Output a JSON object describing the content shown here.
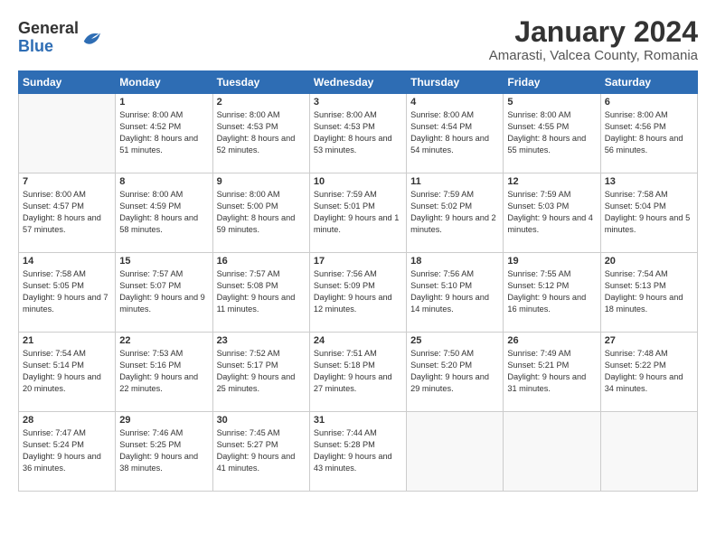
{
  "header": {
    "logo_general": "General",
    "logo_blue": "Blue",
    "month_title": "January 2024",
    "subtitle": "Amarasti, Valcea County, Romania"
  },
  "weekdays": [
    "Sunday",
    "Monday",
    "Tuesday",
    "Wednesday",
    "Thursday",
    "Friday",
    "Saturday"
  ],
  "weeks": [
    [
      {
        "day": "",
        "sunrise": "",
        "sunset": "",
        "daylight": ""
      },
      {
        "day": "1",
        "sunrise": "Sunrise: 8:00 AM",
        "sunset": "Sunset: 4:52 PM",
        "daylight": "Daylight: 8 hours and 51 minutes."
      },
      {
        "day": "2",
        "sunrise": "Sunrise: 8:00 AM",
        "sunset": "Sunset: 4:53 PM",
        "daylight": "Daylight: 8 hours and 52 minutes."
      },
      {
        "day": "3",
        "sunrise": "Sunrise: 8:00 AM",
        "sunset": "Sunset: 4:53 PM",
        "daylight": "Daylight: 8 hours and 53 minutes."
      },
      {
        "day": "4",
        "sunrise": "Sunrise: 8:00 AM",
        "sunset": "Sunset: 4:54 PM",
        "daylight": "Daylight: 8 hours and 54 minutes."
      },
      {
        "day": "5",
        "sunrise": "Sunrise: 8:00 AM",
        "sunset": "Sunset: 4:55 PM",
        "daylight": "Daylight: 8 hours and 55 minutes."
      },
      {
        "day": "6",
        "sunrise": "Sunrise: 8:00 AM",
        "sunset": "Sunset: 4:56 PM",
        "daylight": "Daylight: 8 hours and 56 minutes."
      }
    ],
    [
      {
        "day": "7",
        "sunrise": "Sunrise: 8:00 AM",
        "sunset": "Sunset: 4:57 PM",
        "daylight": "Daylight: 8 hours and 57 minutes."
      },
      {
        "day": "8",
        "sunrise": "Sunrise: 8:00 AM",
        "sunset": "Sunset: 4:59 PM",
        "daylight": "Daylight: 8 hours and 58 minutes."
      },
      {
        "day": "9",
        "sunrise": "Sunrise: 8:00 AM",
        "sunset": "Sunset: 5:00 PM",
        "daylight": "Daylight: 8 hours and 59 minutes."
      },
      {
        "day": "10",
        "sunrise": "Sunrise: 7:59 AM",
        "sunset": "Sunset: 5:01 PM",
        "daylight": "Daylight: 9 hours and 1 minute."
      },
      {
        "day": "11",
        "sunrise": "Sunrise: 7:59 AM",
        "sunset": "Sunset: 5:02 PM",
        "daylight": "Daylight: 9 hours and 2 minutes."
      },
      {
        "day": "12",
        "sunrise": "Sunrise: 7:59 AM",
        "sunset": "Sunset: 5:03 PM",
        "daylight": "Daylight: 9 hours and 4 minutes."
      },
      {
        "day": "13",
        "sunrise": "Sunrise: 7:58 AM",
        "sunset": "Sunset: 5:04 PM",
        "daylight": "Daylight: 9 hours and 5 minutes."
      }
    ],
    [
      {
        "day": "14",
        "sunrise": "Sunrise: 7:58 AM",
        "sunset": "Sunset: 5:05 PM",
        "daylight": "Daylight: 9 hours and 7 minutes."
      },
      {
        "day": "15",
        "sunrise": "Sunrise: 7:57 AM",
        "sunset": "Sunset: 5:07 PM",
        "daylight": "Daylight: 9 hours and 9 minutes."
      },
      {
        "day": "16",
        "sunrise": "Sunrise: 7:57 AM",
        "sunset": "Sunset: 5:08 PM",
        "daylight": "Daylight: 9 hours and 11 minutes."
      },
      {
        "day": "17",
        "sunrise": "Sunrise: 7:56 AM",
        "sunset": "Sunset: 5:09 PM",
        "daylight": "Daylight: 9 hours and 12 minutes."
      },
      {
        "day": "18",
        "sunrise": "Sunrise: 7:56 AM",
        "sunset": "Sunset: 5:10 PM",
        "daylight": "Daylight: 9 hours and 14 minutes."
      },
      {
        "day": "19",
        "sunrise": "Sunrise: 7:55 AM",
        "sunset": "Sunset: 5:12 PM",
        "daylight": "Daylight: 9 hours and 16 minutes."
      },
      {
        "day": "20",
        "sunrise": "Sunrise: 7:54 AM",
        "sunset": "Sunset: 5:13 PM",
        "daylight": "Daylight: 9 hours and 18 minutes."
      }
    ],
    [
      {
        "day": "21",
        "sunrise": "Sunrise: 7:54 AM",
        "sunset": "Sunset: 5:14 PM",
        "daylight": "Daylight: 9 hours and 20 minutes."
      },
      {
        "day": "22",
        "sunrise": "Sunrise: 7:53 AM",
        "sunset": "Sunset: 5:16 PM",
        "daylight": "Daylight: 9 hours and 22 minutes."
      },
      {
        "day": "23",
        "sunrise": "Sunrise: 7:52 AM",
        "sunset": "Sunset: 5:17 PM",
        "daylight": "Daylight: 9 hours and 25 minutes."
      },
      {
        "day": "24",
        "sunrise": "Sunrise: 7:51 AM",
        "sunset": "Sunset: 5:18 PM",
        "daylight": "Daylight: 9 hours and 27 minutes."
      },
      {
        "day": "25",
        "sunrise": "Sunrise: 7:50 AM",
        "sunset": "Sunset: 5:20 PM",
        "daylight": "Daylight: 9 hours and 29 minutes."
      },
      {
        "day": "26",
        "sunrise": "Sunrise: 7:49 AM",
        "sunset": "Sunset: 5:21 PM",
        "daylight": "Daylight: 9 hours and 31 minutes."
      },
      {
        "day": "27",
        "sunrise": "Sunrise: 7:48 AM",
        "sunset": "Sunset: 5:22 PM",
        "daylight": "Daylight: 9 hours and 34 minutes."
      }
    ],
    [
      {
        "day": "28",
        "sunrise": "Sunrise: 7:47 AM",
        "sunset": "Sunset: 5:24 PM",
        "daylight": "Daylight: 9 hours and 36 minutes."
      },
      {
        "day": "29",
        "sunrise": "Sunrise: 7:46 AM",
        "sunset": "Sunset: 5:25 PM",
        "daylight": "Daylight: 9 hours and 38 minutes."
      },
      {
        "day": "30",
        "sunrise": "Sunrise: 7:45 AM",
        "sunset": "Sunset: 5:27 PM",
        "daylight": "Daylight: 9 hours and 41 minutes."
      },
      {
        "day": "31",
        "sunrise": "Sunrise: 7:44 AM",
        "sunset": "Sunset: 5:28 PM",
        "daylight": "Daylight: 9 hours and 43 minutes."
      },
      {
        "day": "",
        "sunrise": "",
        "sunset": "",
        "daylight": ""
      },
      {
        "day": "",
        "sunrise": "",
        "sunset": "",
        "daylight": ""
      },
      {
        "day": "",
        "sunrise": "",
        "sunset": "",
        "daylight": ""
      }
    ]
  ]
}
